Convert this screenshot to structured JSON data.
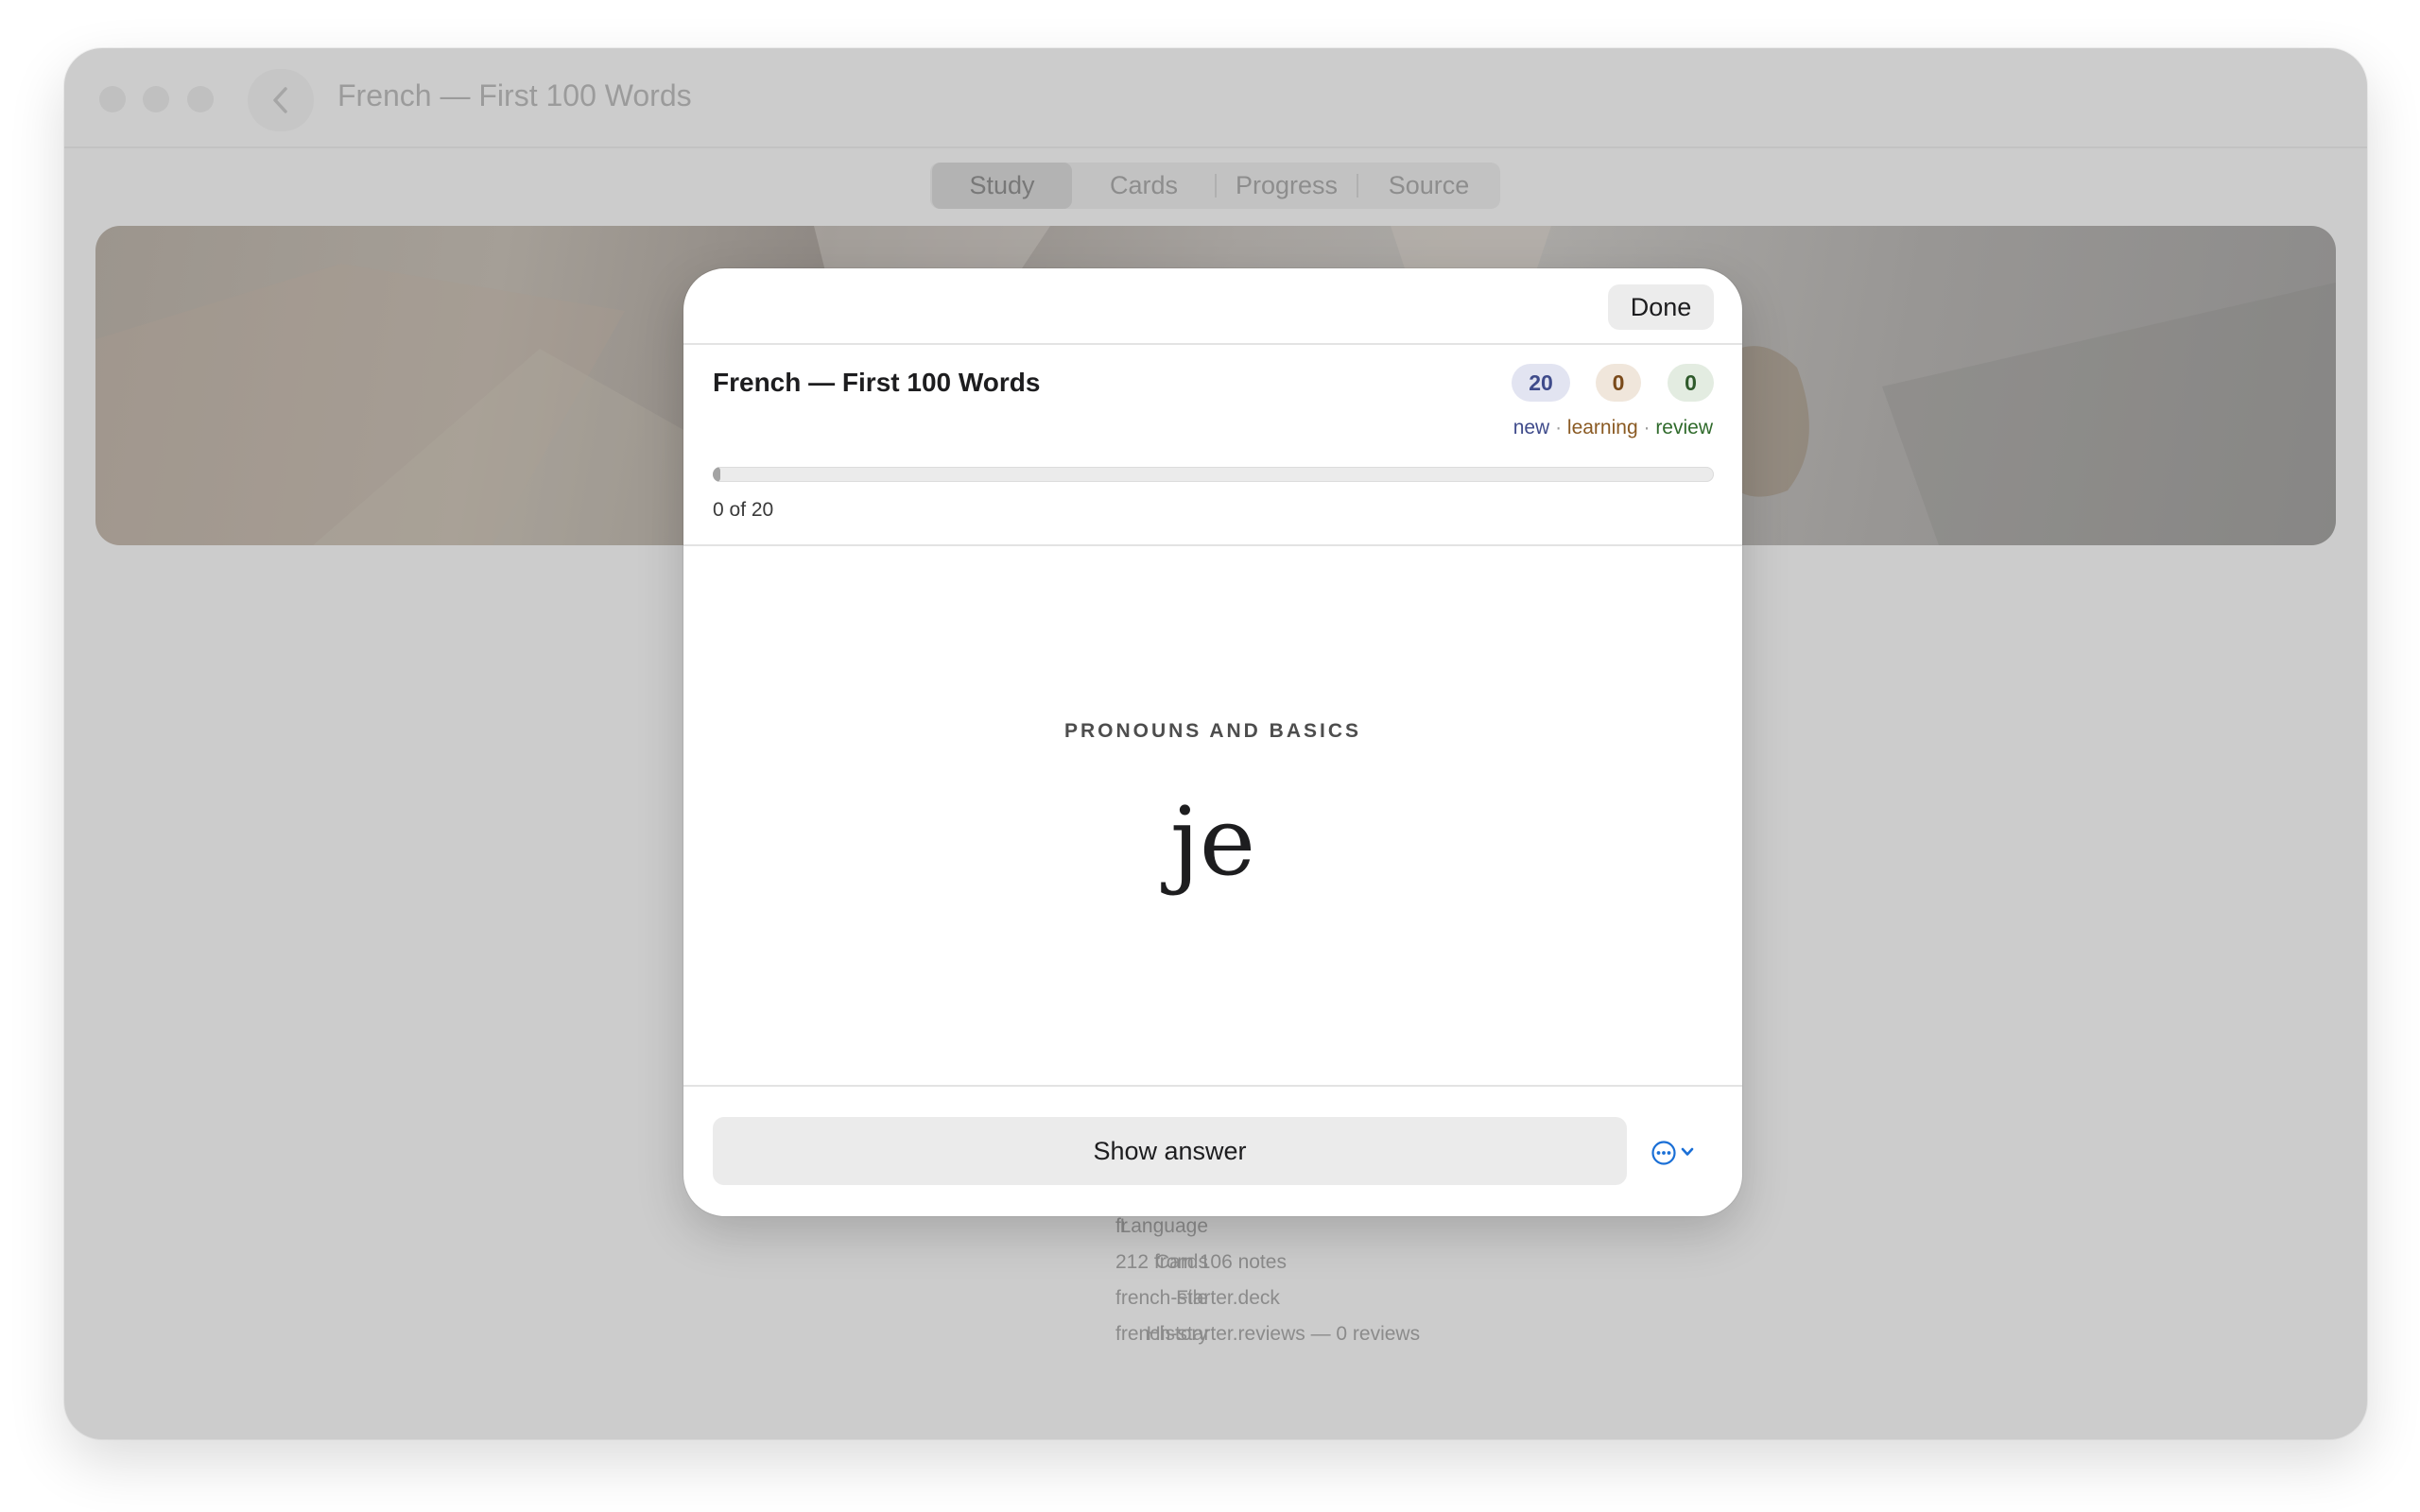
{
  "window": {
    "title": "French — First 100 Words"
  },
  "tabs": [
    {
      "label": "Study",
      "selected": true
    },
    {
      "label": "Cards",
      "selected": false
    },
    {
      "label": "Progress",
      "selected": false
    },
    {
      "label": "Source",
      "selected": false
    }
  ],
  "details": [
    {
      "label": "Language",
      "value": "fr"
    },
    {
      "label": "Cards",
      "value": "212 from 106 notes"
    },
    {
      "label": "File",
      "value": "french-starter.deck"
    },
    {
      "label": "History",
      "value": "french-starter.reviews — 0 reviews"
    }
  ],
  "study": {
    "done_label": "Done",
    "deck_title": "French — First 100 Words",
    "counts": {
      "new": "20",
      "learning": "0",
      "review": "0"
    },
    "legend": {
      "new": "new",
      "learning": "learning",
      "review": "review",
      "separator": " · "
    },
    "progress": {
      "text": "0 of 20",
      "fraction": 0
    },
    "card": {
      "category": "PRONOUNS AND BASICS",
      "front": "je"
    },
    "show_answer_label": "Show answer"
  },
  "colors": {
    "accent": "#1a6fd6",
    "new": "#3f4b8b",
    "learning": "#8a5a23",
    "review": "#2f6a2b"
  },
  "icons": {
    "back": "chevron-left-icon",
    "more": "ellipsis-circle-icon",
    "more_menu": "chevron-down-icon"
  }
}
